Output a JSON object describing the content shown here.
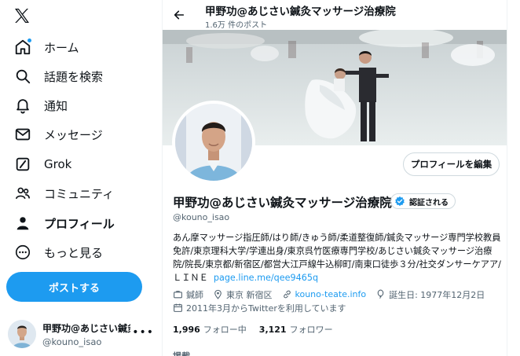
{
  "sidebar": {
    "logo": "x-logo",
    "items": [
      {
        "label": "ホーム",
        "icon": "home-icon",
        "notification": true
      },
      {
        "label": "話題を検索",
        "icon": "search-icon"
      },
      {
        "label": "通知",
        "icon": "bell-icon"
      },
      {
        "label": "メッセージ",
        "icon": "envelope-icon"
      },
      {
        "label": "Grok",
        "icon": "grok-icon"
      },
      {
        "label": "コミュニティ",
        "icon": "people-icon"
      },
      {
        "label": "プロフィール",
        "icon": "person-icon",
        "active": true
      },
      {
        "label": "もっと見る",
        "icon": "more-circle-icon"
      }
    ],
    "post_button": "ポストする"
  },
  "account": {
    "name": "甲野功@あじさい鍼灸マッサージ治療院",
    "handle": "@kouno_isao",
    "more": "•••"
  },
  "header": {
    "title": "甲野功@あじさい鍼灸マッサージ治療院",
    "post_count": "1.6万 件のポスト"
  },
  "profile": {
    "edit_button": "プロフィールを編集",
    "name": "甲野功@あじさい鍼灸マッサージ治療院",
    "verified_label": "認証される",
    "handle": "@kouno_isao",
    "bio": "あん摩マッサージ指圧師/はり師/きゅう師/柔道整復師/鍼灸マッサージ専門学校教員免許/東京理科大学/学連出身/東京呉竹医療専門学校/あじさい鍼灸マッサージ治療院/院長/東京都/新宿区/都営大江戸線牛込柳町/南東口徒歩３分/社交ダンサーケアア/ＬＩＮＥ ",
    "bio_link": "page.line.me/qee9465q",
    "occupation": "鍼師",
    "location": "東京 新宿区",
    "website": "kouno-teate.info",
    "birthday": "誕生日: 1977年12月2日",
    "joined": "2011年3月からTwitterを利用しています",
    "following_count": "1,996",
    "following_label": "フォロー中",
    "followers_count": "3,121",
    "followers_label": "フォロワー",
    "pinned_label": "掲載"
  },
  "colors": {
    "accent": "#1d9bf0",
    "text": "#0f1419",
    "muted": "#536471",
    "border": "#cfd9de"
  }
}
